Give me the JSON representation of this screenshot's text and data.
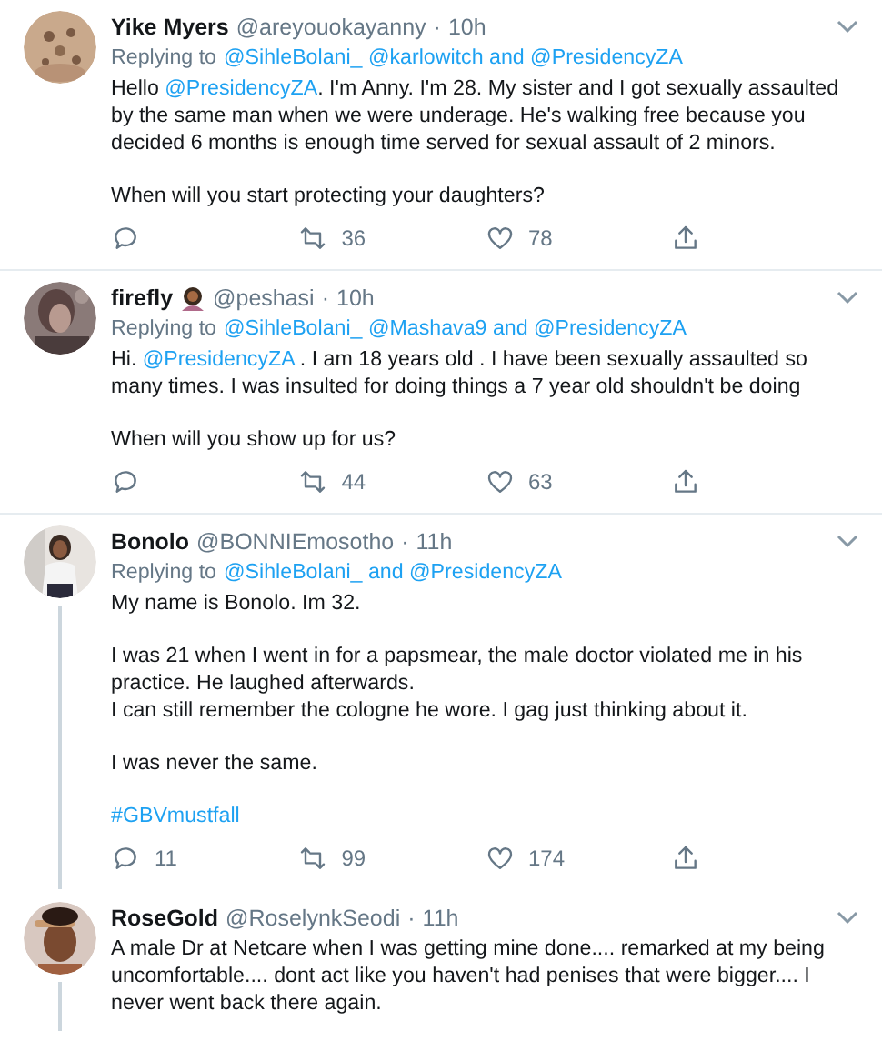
{
  "tweets": [
    {
      "name": "Yike Myers",
      "handle": "@areyouokayanny",
      "separator": "·",
      "time": "10h",
      "thread_line": false,
      "replying_to": {
        "label": "Replying to",
        "mentions": "@SihleBolani_ @karlowitch and @PresidencyZA"
      },
      "paragraphs": [
        [
          {
            "kind": "plain",
            "text": "Hello "
          },
          {
            "kind": "mention",
            "text": "@PresidencyZA"
          },
          {
            "kind": "plain",
            "text": ". I'm Anny. I'm 28. My sister and I got sexually assaulted by the same man when we were underage. He's walking free because you decided 6 months is enough time served for sexual assault of 2 minors."
          }
        ],
        [
          {
            "kind": "plain",
            "text": "When will you start protecting your daughters?"
          }
        ]
      ],
      "actions": {
        "retweets": "36",
        "likes": "78"
      }
    },
    {
      "name": "firefly",
      "has_emoji": true,
      "handle": "@peshasi",
      "separator": "·",
      "time": "10h",
      "thread_line": false,
      "replying_to": {
        "label": "Replying to",
        "mentions": "@SihleBolani_ @Mashava9 and @PresidencyZA"
      },
      "paragraphs": [
        [
          {
            "kind": "plain",
            "text": "Hi. "
          },
          {
            "kind": "mention",
            "text": "@PresidencyZA"
          },
          {
            "kind": "plain",
            "text": " . I am 18 years old . I have been sexually assaulted so many times. I was insulted for doing things a 7 year old shouldn't be doing"
          }
        ],
        [
          {
            "kind": "plain",
            "text": "When will you show up for us?"
          }
        ]
      ],
      "actions": {
        "retweets": "44",
        "likes": "63"
      }
    },
    {
      "name": "Bonolo",
      "handle": "@BONNIEmosotho",
      "separator": "·",
      "time": "11h",
      "thread_line": true,
      "replying_to": {
        "label": "Replying to",
        "mentions": "@SihleBolani_ and @PresidencyZA"
      },
      "paragraphs": [
        [
          {
            "kind": "plain",
            "text": "My name is Bonolo. Im 32."
          }
        ],
        [
          {
            "kind": "plain",
            "text": "I was 21 when I went in for a papsmear, the male doctor violated me in his practice. He laughed afterwards.\nI can still remember the cologne he wore. I gag just thinking about it."
          }
        ],
        [
          {
            "kind": "plain",
            "text": "I was never the same."
          }
        ],
        [
          {
            "kind": "mention",
            "text": "#GBVmustfall"
          }
        ]
      ],
      "actions": {
        "replies": "11",
        "retweets": "99",
        "likes": "174"
      }
    },
    {
      "name": "RoseGold",
      "handle": "@RoselynkSeodi",
      "separator": "·",
      "time": "11h",
      "thread_line": true,
      "paragraphs": [
        [
          {
            "kind": "plain",
            "text": "A male Dr at Netcare when I was getting mine done.... remarked at my being uncomfortable.... dont act like you haven't had penises that were bigger.... I never went back there again."
          }
        ]
      ]
    }
  ]
}
